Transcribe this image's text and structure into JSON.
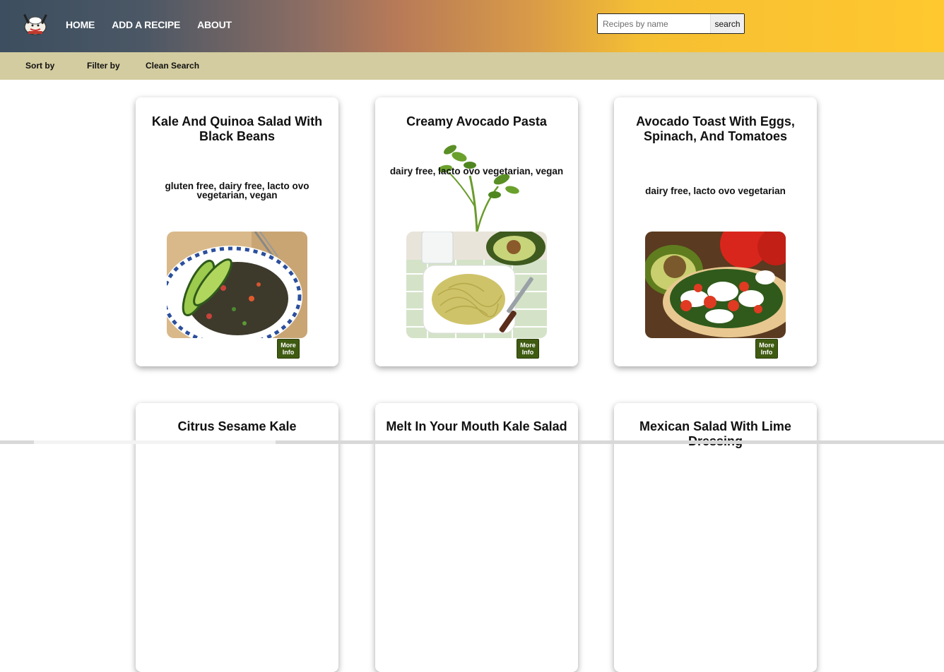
{
  "nav": {
    "links": [
      "HOME",
      "ADD A RECIPE",
      "ABOUT"
    ]
  },
  "search": {
    "placeholder": "Recipes by name",
    "button": "search"
  },
  "toolbar": {
    "sort": "Sort by",
    "filter": "Filter by",
    "clean": "Clean Search"
  },
  "recipes": [
    {
      "title": "Kale And Quinoa Salad With Black Beans",
      "diets": "gluten free, dairy free, lacto ovo vegetarian, vegan",
      "more": "More Info"
    },
    {
      "title": "Creamy Avocado Pasta",
      "diets": "dairy free, lacto ovo vegetarian, vegan",
      "more": "More Info"
    },
    {
      "title": "Avocado Toast With Eggs, Spinach, And Tomatoes",
      "diets": "dairy free, lacto ovo vegetarian",
      "more": "More Info"
    },
    {
      "title": "Citrus Sesame Kale"
    },
    {
      "title": "Melt In Your Mouth Kale Salad"
    },
    {
      "title": "Mexican Salad With Lime Dressing"
    }
  ],
  "colors": {
    "header_start": "#3c4e5f",
    "header_end": "#ffc82f",
    "toolbar_bg": "#d3cca0",
    "more_button": "#3f5b12"
  }
}
